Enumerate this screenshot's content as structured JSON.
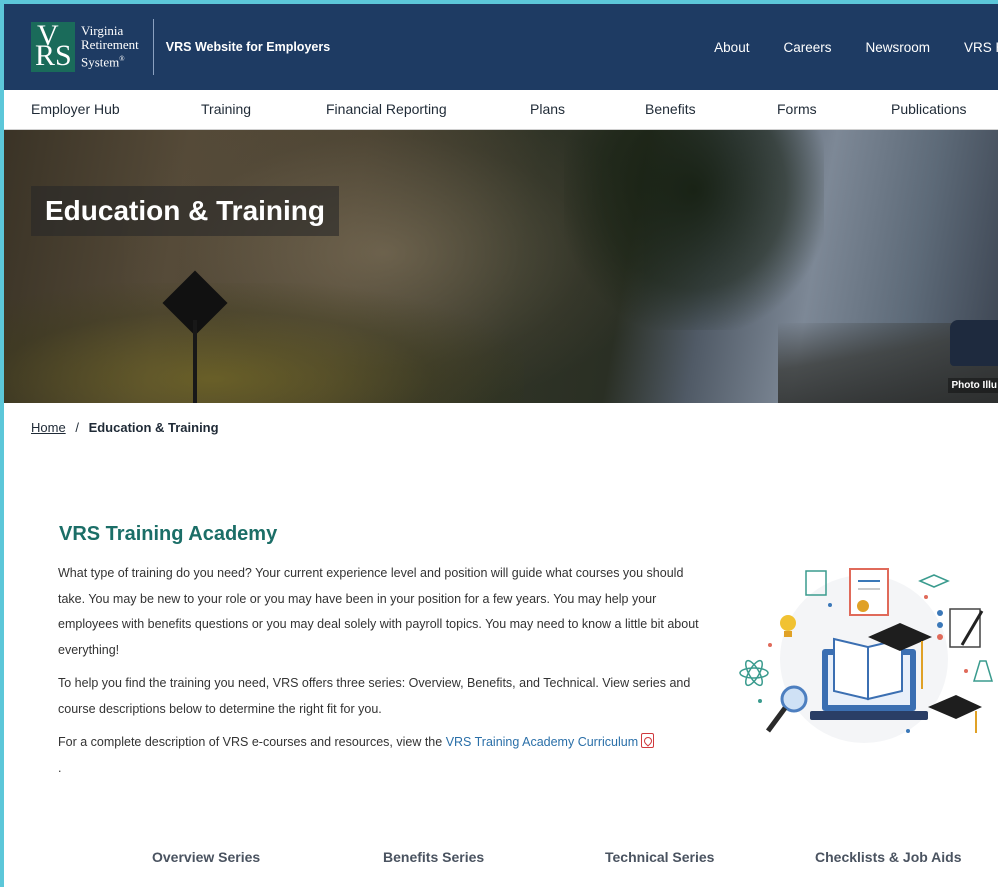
{
  "header": {
    "logo": {
      "line1": "Virginia",
      "line2": "Retirement",
      "line3": "System",
      "mark": "VRS"
    },
    "site_title": "VRS Website for Employers",
    "util_nav": [
      "About",
      "Careers",
      "Newsroom",
      "VRS Hom"
    ]
  },
  "main_nav": [
    "Employer Hub",
    "Training",
    "Financial Reporting",
    "Plans",
    "Benefits",
    "Forms",
    "Publications"
  ],
  "hero": {
    "title": "Education & Training",
    "photo_credit": "Photo Illu"
  },
  "breadcrumb": {
    "home": "Home",
    "separator": "/",
    "current": "Education & Training"
  },
  "academy": {
    "title": "VRS Training Academy",
    "p1": "What type of training do you need? Your current experience level and position will guide what courses you should take. You may be new to your role or you may have been in your position for a few years. You may help your employees with benefits questions or you may deal solely with payroll topics. You may need to know a little bit about everything!",
    "p2": "To help you find the training you need, VRS offers three series: Overview, Benefits, and Technical. View series and course descriptions below to determine the right fit for you.",
    "p3_prefix": "For a complete description of VRS e-courses and resources, view the ",
    "p3_link": "VRS Training Academy Curriculum",
    "p3_suffix": "."
  },
  "tabs": [
    "Overview Series",
    "Benefits Series",
    "Technical Series",
    "Checklists & Job Aids"
  ],
  "colors": {
    "header_bg": "#1e3b63",
    "title_teal": "#1b6e67",
    "link_blue": "#2a6fa8",
    "frame_border": "#5cc7d9"
  }
}
